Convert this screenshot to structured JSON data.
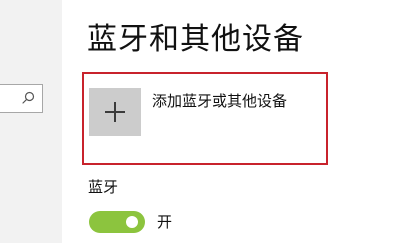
{
  "page": {
    "title": "蓝牙和其他设备"
  },
  "add_device": {
    "label": "添加蓝牙或其他设备",
    "icon": "plus-icon"
  },
  "bluetooth": {
    "section_label": "蓝牙",
    "toggle_state_label": "开",
    "enabled": true
  },
  "sidebar": {
    "search_icon": "search-icon"
  },
  "colors": {
    "toggle_on": "#8cc43e",
    "highlight_border": "#c8232c",
    "add_button_bg": "#cccccc",
    "sidebar_bg": "#f2f2f2"
  }
}
